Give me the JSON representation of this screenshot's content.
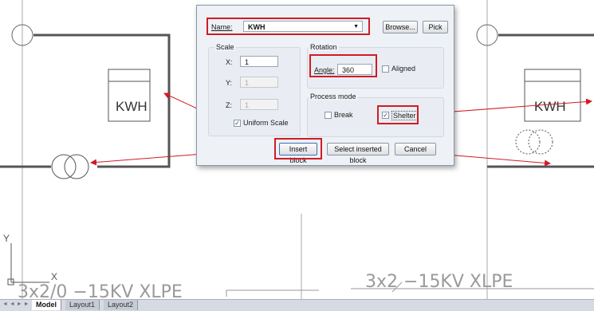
{
  "drawing": {
    "left_meter_label": "KWH",
    "right_meter_label": "KWH",
    "cable_left": "3x2/0 −15KV XLPE",
    "cable_right": "3x2  −15KV  XLPE",
    "ucs_y_label": "Y",
    "ucs_x_label": "X"
  },
  "dialog": {
    "name_label": "Name:",
    "name_value": "KWH",
    "browse_label": "Browse...",
    "pick_label": "Pick",
    "scale_title": "Scale",
    "x_label": "X:",
    "x_value": "1",
    "y_label": "Y:",
    "y_value": "1",
    "z_label": "Z:",
    "z_value": "1",
    "uniform_scale_label": "Uniform Scale",
    "uniform_scale_checked": true,
    "rotation_title": "Rotation",
    "angle_label": "Angle:",
    "angle_value": "360",
    "aligned_label": "Aligned",
    "aligned_checked": false,
    "process_mode_title": "Process mode",
    "break_label": "Break",
    "break_checked": false,
    "shelter_label": "Shelter",
    "shelter_checked": true,
    "insert_block_label": "Insert block",
    "select_inserted_label": "Select inserted block",
    "cancel_label": "Cancel"
  },
  "tabs": {
    "nav": "◄ ◄ ► ►",
    "items": [
      "Model",
      "Layout1",
      "Layout2"
    ],
    "active": "Model"
  },
  "colors": {
    "annotation_red": "#d01c25",
    "wire": "#555555",
    "cad_text": "#9a9a9a"
  }
}
